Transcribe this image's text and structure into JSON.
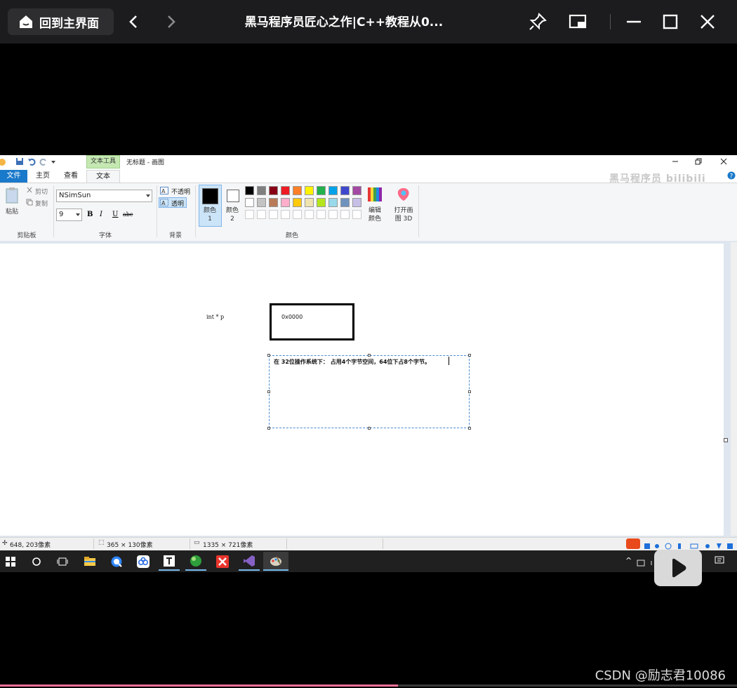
{
  "player": {
    "home_label": "回到主界面",
    "title": "黑马程序员匠心之作|C++教程从0...",
    "progress": 0.54
  },
  "paint": {
    "window_title": "无标题 - 画图",
    "context_tab": "文本工具",
    "tabs": [
      "文件",
      "主页",
      "查看",
      "文本"
    ],
    "active_tab": "文本",
    "watermark": "黑马程序员 bilibili",
    "clipboard": {
      "paste": "粘贴",
      "cut": "剪切",
      "copy": "复制",
      "group": "剪贴板"
    },
    "font": {
      "family": "NSimSun",
      "size": "9",
      "group": "字体",
      "bold": "B",
      "italic": "I",
      "underline": "U",
      "strike": "abc"
    },
    "background": {
      "opaque": "不透明",
      "transparent": "透明",
      "group": "背景"
    },
    "colors": {
      "color1_label": "颜色 1",
      "color2_label": "颜色 2",
      "edit_label": "编辑颜色",
      "paint3d_label": "打开画图 3D",
      "group": "颜色",
      "color1": "#000000",
      "color2": "#ffffff",
      "palette_row1": [
        "#000000",
        "#7f7f7f",
        "#880015",
        "#ed1c24",
        "#ff7f27",
        "#fff200",
        "#22b14c",
        "#00a2e8",
        "#3f48cc",
        "#a349a4"
      ],
      "palette_row2": [
        "#ffffff",
        "#c3c3c3",
        "#b97a57",
        "#ffaec9",
        "#ffc90e",
        "#efe4b0",
        "#b5e61d",
        "#99d9ea",
        "#7092be",
        "#c8bfe7"
      ]
    },
    "canvas": {
      "pointer_label": "int * p",
      "box_text": "0x0000",
      "textbox_content": "在 32位操作系统下： 占用4个字节空间，64位下占8个字节。"
    },
    "status": {
      "cursor_pos": "648, 203像素",
      "selection_size": "365 × 130像素",
      "image_size": "1335 × 721像素"
    }
  },
  "watermark_csdn": "CSDN @励志君10086"
}
